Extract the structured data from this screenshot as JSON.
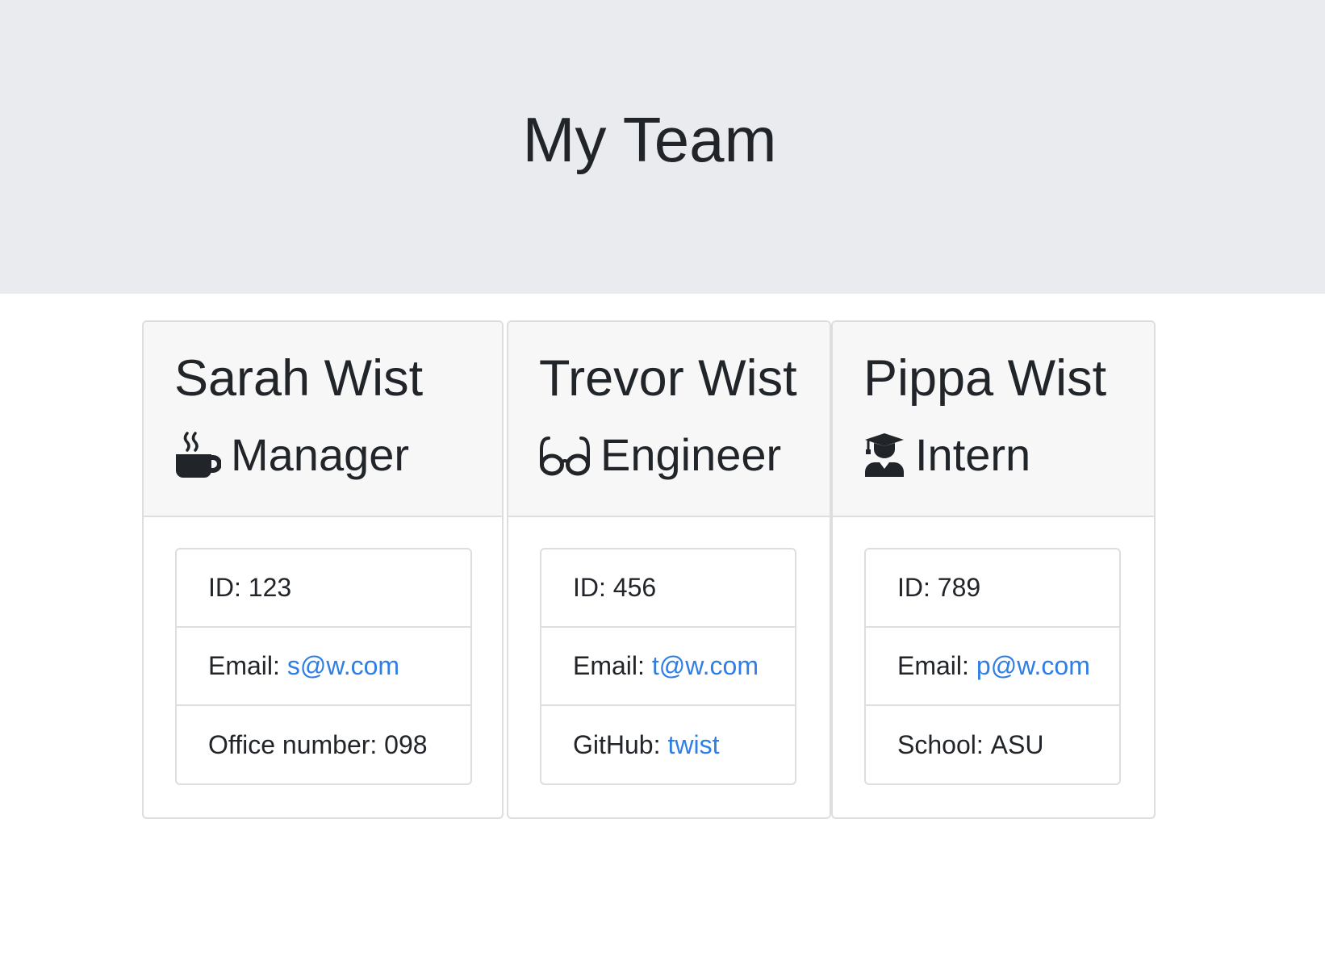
{
  "header": {
    "title": "My Team"
  },
  "employees": [
    {
      "name": "Sarah Wist",
      "role": "Manager",
      "icon": "mug-icon",
      "id_label": "ID:",
      "id": "123",
      "email_label": "Email:",
      "email": "s@w.com",
      "extra_label": "Office number:",
      "extra_value": "098"
    },
    {
      "name": "Trevor Wist",
      "role": "Engineer",
      "icon": "glasses-icon",
      "id_label": "ID:",
      "id": "456",
      "email_label": "Email:",
      "email": "t@w.com",
      "extra_label": "GitHub:",
      "extra_value": "twist"
    },
    {
      "name": "Pippa Wist",
      "role": "Intern",
      "icon": "graduate-icon",
      "id_label": "ID:",
      "id": "789",
      "email_label": "Email:",
      "email": "p@w.com",
      "extra_label": "School:",
      "extra_value": "ASU"
    }
  ],
  "colors": {
    "header_bg": "#e9ebee",
    "card_header_bg": "#f7f7f7",
    "link": "#2f7ee6",
    "text": "#212529",
    "border": "#dedede"
  }
}
